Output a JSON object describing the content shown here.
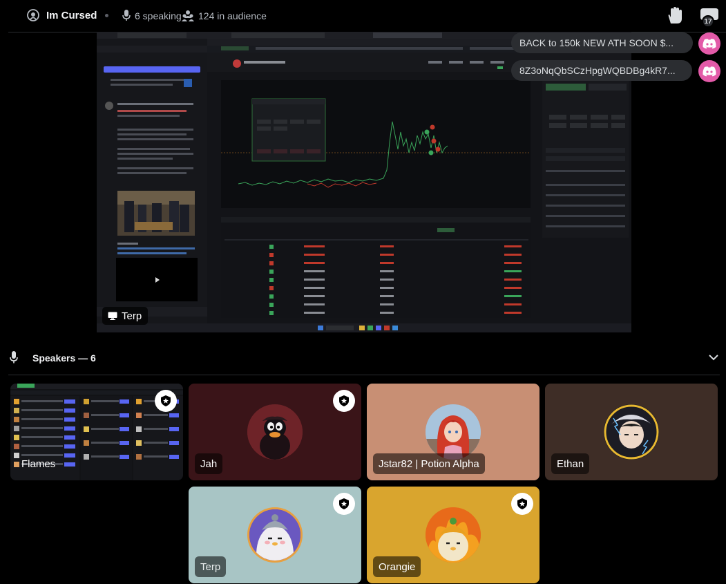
{
  "header": {
    "stage_name": "Im Cursed",
    "speaking": "6 speaking",
    "audience": "124 in audience",
    "thread_count": "17"
  },
  "stream": {
    "streamer": "Terp"
  },
  "chat_toasts": [
    {
      "text": "BACK to 150k NEW ATH SOON $..."
    },
    {
      "text": "8Z3oNqQbSCzHpgWQBDBg4kR7..."
    }
  ],
  "speakers_section": {
    "title": "Speakers — 6"
  },
  "speakers": [
    {
      "name": "Flames",
      "moderator": true,
      "streaming": true
    },
    {
      "name": "Jah",
      "moderator": true
    },
    {
      "name": "Jstar82 | Potion Alpha",
      "moderator": false
    },
    {
      "name": "Ethan",
      "moderator": false
    },
    {
      "name": "Terp",
      "moderator": true
    },
    {
      "name": "Orangie",
      "moderator": true
    }
  ],
  "colors": {
    "tile_jah": "#3a1418",
    "tile_jstar": "#c88f74",
    "tile_ethan": "#3e2d26",
    "tile_terp": "#a8c5c5",
    "tile_orangie": "#d9a52e",
    "discord_avatar": "#e35aa8"
  }
}
